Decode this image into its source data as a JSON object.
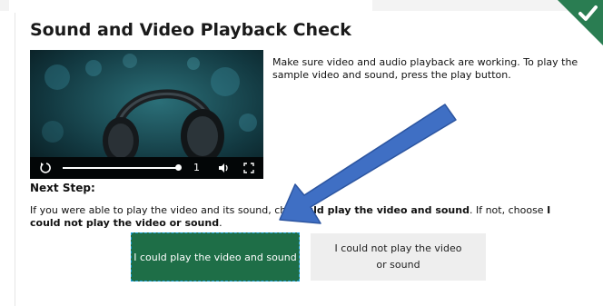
{
  "page": {
    "title": "Sound and Video Playback Check",
    "description": "Make sure video and audio playback are working. To play the sample video and sound, press the play button.",
    "status_icon": "checkmark-icon",
    "status_color": "#2a7d52"
  },
  "video_player": {
    "progress": 0.75,
    "time_value": "1",
    "icons": [
      "replay-icon",
      "volume-icon",
      "fullscreen-icon"
    ]
  },
  "next_step": {
    "heading": "Next Step:",
    "instr_part1": "If you were able to play the video and its sound, ch",
    "instr_bold1": "I could play the video and sound",
    "instr_part2": ". If not, choose ",
    "instr_bold2": "I could not play the video or sound",
    "instr_end": "."
  },
  "buttons": {
    "yes_label": "I could play the video and sound",
    "no_label": "I could not play the video or sound",
    "yes_color": "#1e6e47"
  },
  "annotation": {
    "arrow_color": "#3f6fc4"
  }
}
